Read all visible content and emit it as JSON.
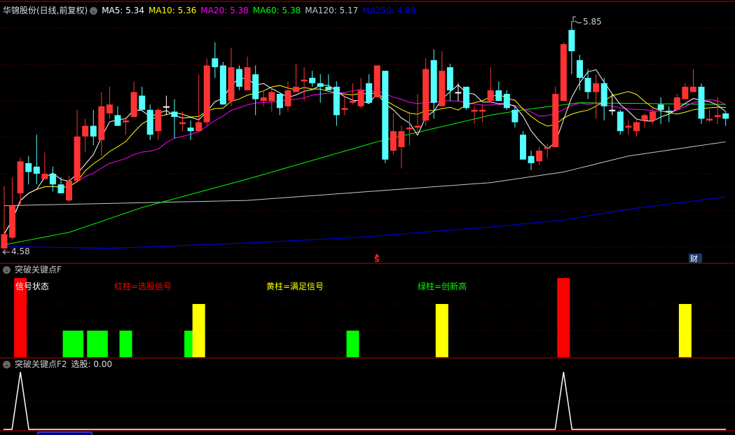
{
  "header": {
    "title": "华锦股份(日线,前复权)",
    "ma": [
      {
        "label": "MA5: 5.34",
        "color": "#ffffff"
      },
      {
        "label": "MA10: 5.36",
        "color": "#ffff00"
      },
      {
        "label": "MA20: 5.38",
        "color": "#ff00ff"
      },
      {
        "label": "MA60: 5.38",
        "color": "#00ff00"
      },
      {
        "label": "MA120: 5.17",
        "color": "#c8c8c8"
      },
      {
        "label": "MA250: 4.88",
        "color": "#0000ff"
      }
    ]
  },
  "markers": {
    "high_label": "5.85",
    "low_label": "4.58",
    "s_marker": "S",
    "cai_marker": "财"
  },
  "panel2": {
    "title": "突破关键点F",
    "legend": [
      "信号状态",
      "红柱=选股信号",
      "黄柱=满足信号",
      "绿柱=创新高"
    ],
    "legend_colors": [
      "#ffffff",
      "#ff0000",
      "#ffff00",
      "#00ff00"
    ]
  },
  "panel3": {
    "title": "突破关键点F2",
    "value_label": "选股: 0.00"
  },
  "colors": {
    "up": "#ff3333",
    "down": "#54ffff",
    "flat": "#ffffff",
    "grid": "#8b0000",
    "border": "#c00000"
  },
  "chart_data": {
    "type": "candlestick",
    "price_range": [
      4.58,
      5.85
    ],
    "ohlc": [
      [
        4.57,
        4.92,
        4.56,
        4.65
      ],
      [
        4.63,
        4.97,
        4.62,
        4.81
      ],
      [
        4.88,
        5.08,
        4.81,
        5.06
      ],
      [
        5.05,
        5.09,
        4.93,
        5.0
      ],
      [
        5.03,
        5.21,
        4.93,
        4.99
      ],
      [
        4.96,
        5.11,
        4.96,
        4.99
      ],
      [
        4.99,
        5.03,
        4.89,
        4.93
      ],
      [
        4.93,
        4.97,
        4.88,
        4.88
      ],
      [
        4.84,
        4.98,
        4.83,
        4.95
      ],
      [
        4.95,
        5.35,
        4.95,
        5.2
      ],
      [
        5.2,
        5.3,
        5.11,
        5.26
      ],
      [
        5.26,
        5.35,
        5.15,
        5.2
      ],
      [
        5.18,
        5.45,
        5.09,
        5.37
      ],
      [
        5.33,
        5.48,
        5.3,
        5.38
      ],
      [
        5.32,
        5.37,
        5.26,
        5.26
      ],
      [
        5.28,
        5.31,
        5.21,
        5.29
      ],
      [
        5.31,
        5.51,
        5.31,
        5.45
      ],
      [
        5.43,
        5.48,
        5.35,
        5.35
      ],
      [
        5.35,
        5.38,
        5.18,
        5.21
      ],
      [
        5.23,
        5.36,
        5.18,
        5.35
      ],
      [
        5.37,
        5.43,
        5.32,
        5.37
      ],
      [
        5.34,
        5.41,
        5.19,
        5.31
      ],
      [
        5.27,
        5.34,
        5.23,
        5.28
      ],
      [
        5.25,
        5.29,
        5.18,
        5.23
      ],
      [
        5.23,
        5.55,
        5.23,
        5.28
      ],
      [
        5.28,
        5.64,
        5.26,
        5.6
      ],
      [
        5.64,
        5.73,
        5.53,
        5.59
      ],
      [
        5.6,
        5.62,
        5.38,
        5.38
      ],
      [
        5.4,
        5.7,
        5.37,
        5.59
      ],
      [
        5.58,
        5.6,
        5.46,
        5.48
      ],
      [
        5.46,
        5.65,
        5.46,
        5.59
      ],
      [
        5.55,
        5.6,
        5.32,
        5.41
      ],
      [
        5.4,
        5.46,
        5.37,
        5.42
      ],
      [
        5.4,
        5.48,
        5.34,
        5.45
      ],
      [
        5.44,
        5.44,
        5.32,
        5.36
      ],
      [
        5.37,
        5.51,
        5.34,
        5.46
      ],
      [
        5.45,
        5.61,
        5.45,
        5.48
      ],
      [
        5.51,
        5.59,
        5.4,
        5.52
      ],
      [
        5.53,
        5.57,
        5.48,
        5.5
      ],
      [
        5.5,
        5.55,
        5.39,
        5.48
      ],
      [
        5.48,
        5.55,
        5.46,
        5.46
      ],
      [
        5.48,
        5.51,
        5.26,
        5.32
      ],
      [
        5.35,
        5.43,
        5.32,
        5.36
      ],
      [
        5.39,
        5.5,
        5.38,
        5.4
      ],
      [
        5.37,
        5.53,
        5.36,
        5.46
      ],
      [
        5.5,
        5.55,
        5.39,
        5.39
      ],
      [
        5.42,
        5.6,
        5.42,
        5.6
      ],
      [
        5.57,
        5.57,
        5.05,
        5.07
      ],
      [
        5.12,
        5.33,
        5.1,
        5.23
      ],
      [
        5.14,
        5.26,
        5.02,
        5.23
      ],
      [
        5.24,
        5.34,
        5.15,
        5.25
      ],
      [
        5.25,
        5.44,
        5.22,
        5.26
      ],
      [
        5.29,
        5.64,
        5.26,
        5.58
      ],
      [
        5.63,
        5.69,
        5.3,
        5.39
      ],
      [
        5.37,
        5.68,
        5.37,
        5.57
      ],
      [
        5.59,
        5.61,
        5.4,
        5.46
      ],
      [
        5.45,
        5.5,
        5.4,
        5.45
      ],
      [
        5.48,
        5.48,
        5.35,
        5.36
      ],
      [
        5.34,
        5.37,
        5.27,
        5.35
      ],
      [
        5.34,
        5.38,
        5.28,
        5.35
      ],
      [
        5.4,
        5.59,
        5.39,
        5.46
      ],
      [
        5.46,
        5.51,
        5.4,
        5.4
      ],
      [
        5.44,
        5.46,
        5.35,
        5.36
      ],
      [
        5.35,
        5.37,
        5.25,
        5.28
      ],
      [
        5.21,
        5.23,
        5.07,
        5.07
      ],
      [
        5.09,
        5.12,
        5.01,
        5.05
      ],
      [
        5.06,
        5.14,
        5.04,
        5.12
      ],
      [
        5.13,
        5.16,
        5.08,
        5.14
      ],
      [
        5.14,
        5.48,
        5.14,
        5.44
      ],
      [
        5.4,
        5.73,
        5.4,
        5.72
      ],
      [
        5.8,
        5.85,
        5.55,
        5.68
      ],
      [
        5.63,
        5.66,
        5.46,
        5.53
      ],
      [
        5.53,
        5.58,
        5.41,
        5.45
      ],
      [
        5.45,
        5.55,
        5.3,
        5.5
      ],
      [
        5.5,
        5.53,
        5.29,
        5.37
      ],
      [
        5.35,
        5.44,
        5.32,
        5.35
      ],
      [
        5.34,
        5.35,
        5.21,
        5.23
      ],
      [
        5.25,
        5.29,
        5.21,
        5.26
      ],
      [
        5.23,
        5.29,
        5.2,
        5.28
      ],
      [
        5.29,
        5.33,
        5.25,
        5.32
      ],
      [
        5.29,
        5.36,
        5.27,
        5.34
      ],
      [
        5.38,
        5.42,
        5.27,
        5.35
      ],
      [
        5.345,
        5.37,
        5.28,
        5.34
      ],
      [
        5.35,
        5.44,
        5.35,
        5.42
      ],
      [
        5.41,
        5.5,
        5.41,
        5.48
      ],
      [
        5.45,
        5.58,
        5.45,
        5.48
      ],
      [
        5.48,
        5.5,
        5.27,
        5.3
      ],
      [
        5.29,
        5.35,
        5.28,
        5.3
      ],
      [
        5.31,
        5.42,
        5.27,
        5.32
      ],
      [
        5.33,
        5.34,
        5.26,
        5.3
      ]
    ],
    "ohlc_fields": [
      "open",
      "high",
      "low",
      "close"
    ],
    "ma_long": {
      "MA60": [
        [
          0,
          4.59
        ],
        [
          8,
          4.66
        ],
        [
          17,
          4.8
        ],
        [
          30,
          4.96
        ],
        [
          46,
          5.17
        ],
        [
          60,
          5.32
        ],
        [
          64,
          5.35
        ],
        [
          71,
          5.39
        ],
        [
          89,
          5.38
        ]
      ],
      "MA120": [
        [
          0,
          4.81
        ],
        [
          30,
          4.84
        ],
        [
          60,
          4.94
        ],
        [
          69,
          5.0
        ],
        [
          77,
          5.09
        ],
        [
          89,
          5.17
        ]
      ],
      "MA250": [
        [
          0,
          4.58
        ],
        [
          13,
          4.57
        ],
        [
          30,
          4.6
        ],
        [
          43,
          4.63
        ],
        [
          60,
          4.69
        ],
        [
          69,
          4.73
        ],
        [
          77,
          4.79
        ],
        [
          89,
          4.86
        ]
      ]
    },
    "signals": [
      {
        "index": 2,
        "level": 3,
        "type": "red"
      },
      {
        "index": 8,
        "level": 1,
        "type": "green"
      },
      {
        "index": 9,
        "level": 1,
        "type": "green"
      },
      {
        "index": 11,
        "level": 1,
        "type": "green"
      },
      {
        "index": 12,
        "level": 1,
        "type": "green"
      },
      {
        "index": 15,
        "level": 1,
        "type": "green"
      },
      {
        "index": 24,
        "level": 2,
        "type": "yellow"
      },
      {
        "index": 23,
        "level": 1,
        "type": "green"
      },
      {
        "index": 43,
        "level": 1,
        "type": "green"
      },
      {
        "index": 54,
        "level": 2,
        "type": "yellow"
      },
      {
        "index": 69,
        "level": 3,
        "type": "red"
      },
      {
        "index": 84,
        "level": 2,
        "type": "yellow"
      }
    ],
    "xuangu_peaks": [
      2,
      69
    ]
  }
}
